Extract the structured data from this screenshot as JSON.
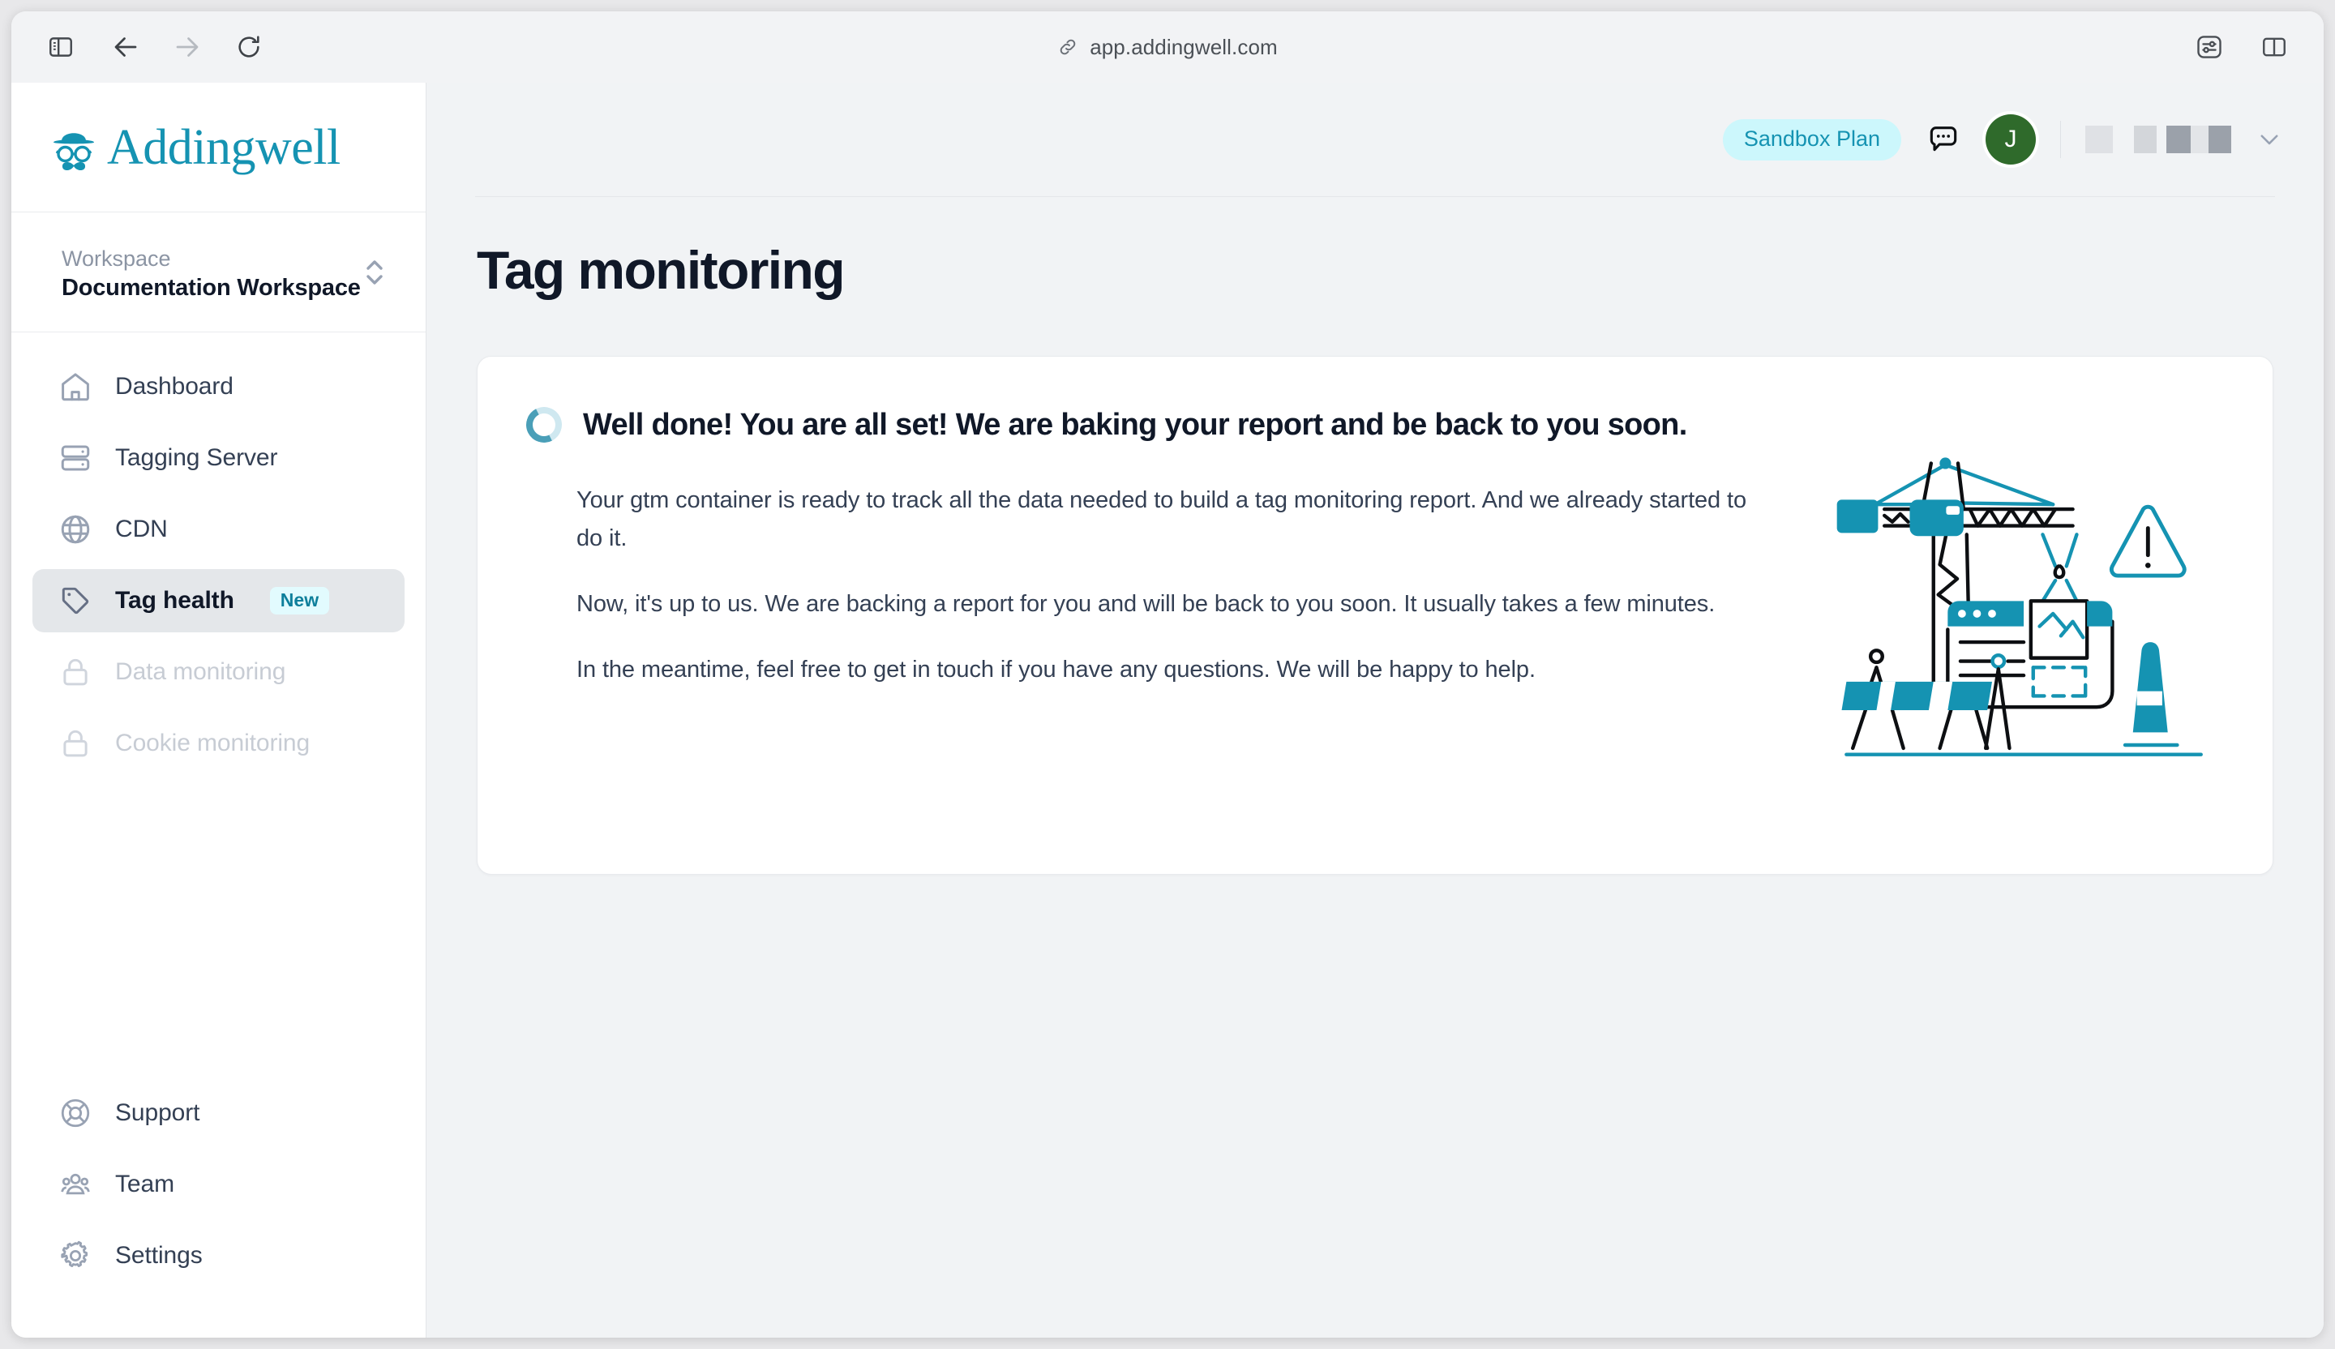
{
  "browser": {
    "toolbar_icons": [
      "sidebar-toggle-icon",
      "back-arrow-icon",
      "forward-arrow-icon",
      "reload-icon"
    ],
    "url": "app.addingwell.com",
    "url_icon": "link-icon",
    "right_icons": [
      "reader-settings-icon",
      "tab-overview-icon"
    ]
  },
  "sidebar": {
    "logo": {
      "icon": "addingwell-gentleman-icon",
      "wordmark": "Addingwell"
    },
    "workspace": {
      "label": "Workspace",
      "value": "Documentation Workspace",
      "switcher_icon": "chevron-up-down-icon"
    },
    "primary_items": [
      {
        "label": "Dashboard",
        "icon": "home-icon",
        "state": "default"
      },
      {
        "label": "Tagging Server",
        "icon": "server-icon",
        "state": "default"
      },
      {
        "label": "CDN",
        "icon": "globe-icon",
        "state": "default"
      },
      {
        "label": "Tag health",
        "icon": "tag-icon",
        "state": "active",
        "badge": "New"
      },
      {
        "label": "Data monitoring",
        "icon": "lock-icon",
        "state": "disabled"
      },
      {
        "label": "Cookie monitoring",
        "icon": "lock-icon",
        "state": "disabled"
      }
    ],
    "bottom_items": [
      {
        "label": "Support",
        "icon": "lifebuoy-icon"
      },
      {
        "label": "Team",
        "icon": "users-icon"
      },
      {
        "label": "Settings",
        "icon": "gear-icon"
      }
    ]
  },
  "header": {
    "plan_badge": "Sandbox Plan",
    "chat_icon": "chat-bubble-icon",
    "avatar_initial": "J",
    "account_chevron_icon": "chevron-down-icon"
  },
  "main": {
    "page_title": "Tag monitoring",
    "card": {
      "status_icon": "loading-spinner-icon",
      "title": "Well done! You are all set! We are baking your report and be back to you soon.",
      "paragraphs": [
        "Your gtm container is ready to track all the data needed to build a tag monitoring report. And we already started to do it.",
        "Now, it's up to us. We are backing a report for you and will be back to you soon. It usually takes a few minutes.",
        "In the meantime, feel free to get in touch if you have any questions. We will be happy to help."
      ],
      "illustration_icon": "construction-crane-illustration"
    }
  },
  "colors": {
    "brand_teal": "#1593b2",
    "badge_bg": "#ccf7fc",
    "new_badge_bg": "#e2fbfe",
    "avatar_green": "#2f6a2b",
    "page_bg": "#f1f3f5",
    "text_dark": "#101828"
  }
}
